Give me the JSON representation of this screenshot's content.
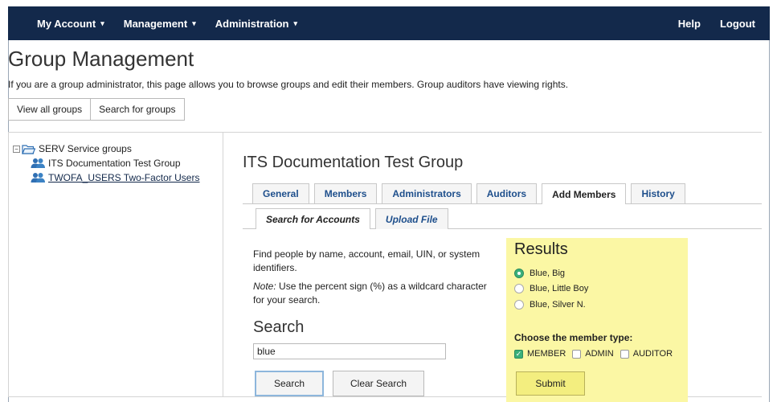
{
  "navbar": {
    "left": [
      {
        "label": "My Account",
        "caret": "▾"
      },
      {
        "label": "Management",
        "caret": "▾"
      },
      {
        "label": "Administration",
        "caret": "▾"
      }
    ],
    "right": [
      {
        "label": "Help"
      },
      {
        "label": "Logout"
      }
    ]
  },
  "page": {
    "title": "Group Management",
    "intro": "If you are a group administrator, this page allows you to browse groups and edit their members. Group auditors have viewing rights."
  },
  "view_buttons": [
    "View all groups",
    "Search for groups"
  ],
  "tree": {
    "root": {
      "label": "SERV Service groups",
      "expander": "−"
    },
    "children": [
      {
        "label": "ITS Documentation Test Group"
      },
      {
        "label": "TWOFA_USERS Two-Factor Users"
      }
    ]
  },
  "group": {
    "title": "ITS Documentation Test Group",
    "tabs": [
      "General",
      "Members",
      "Administrators",
      "Auditors",
      "Add Members",
      "History"
    ],
    "active_tab": "Add Members",
    "subtabs": [
      "Search for Accounts",
      "Upload File"
    ],
    "active_subtab": "Search for Accounts"
  },
  "search": {
    "description": "Find people by name, account, email, UIN, or system identifiers.",
    "note_label": "Note:",
    "note_text": " Use the percent sign (%) as a wildcard character for your search.",
    "heading": "Search",
    "value": "blue",
    "search_label": "Search",
    "clear_label": "Clear Search"
  },
  "results": {
    "title": "Results",
    "items": [
      "Blue, Big",
      "Blue, Little Boy",
      "Blue, Silver N."
    ],
    "selected": "Blue, Big",
    "member_type_label": "Choose the member type:",
    "types": [
      {
        "label": "MEMBER",
        "checked": true
      },
      {
        "label": "ADMIN",
        "checked": false
      },
      {
        "label": "AUDITOR",
        "checked": false
      }
    ],
    "submit_label": "Submit",
    "highlight_color": "#fbf7a4"
  },
  "colors": {
    "navbar": "#13294b",
    "link": "#1e4f8c",
    "selected": "#3ab07a"
  }
}
